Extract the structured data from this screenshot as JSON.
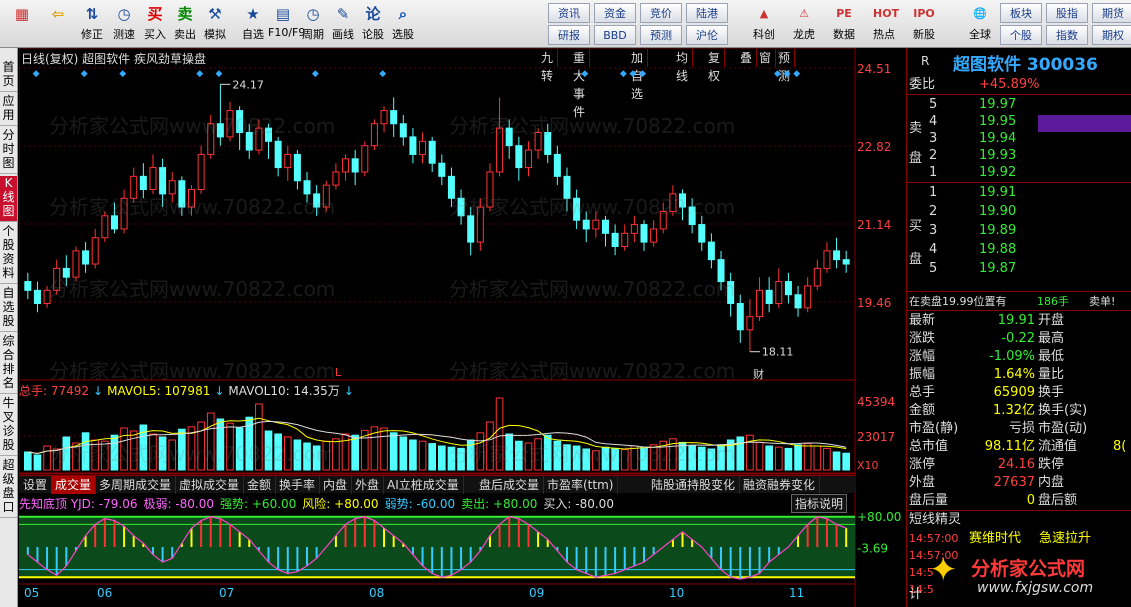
{
  "toolbar": {
    "left": [
      {
        "label": "",
        "icon": "grid-icon"
      },
      {
        "label": "",
        "icon": "back-arrow-icon"
      },
      {
        "label": "修正",
        "icon": "updown-icon"
      },
      {
        "label": "测速",
        "icon": "clock-icon"
      },
      {
        "label": "买入",
        "icon": "buy-icon",
        "glyph": "买"
      },
      {
        "label": "卖出",
        "icon": "sell-icon",
        "glyph": "卖"
      },
      {
        "label": "模拟",
        "icon": "hammer-icon"
      },
      {
        "label": "自选",
        "icon": "star-icon"
      },
      {
        "label": "F10/F9",
        "icon": "f10-icon"
      },
      {
        "label": "周期",
        "icon": "clock-icon"
      },
      {
        "label": "画线",
        "icon": "pen-icon"
      },
      {
        "label": "论股",
        "icon": "chat-icon"
      },
      {
        "label": "选股",
        "icon": "magnifier-icon"
      }
    ],
    "grid1": [
      "资讯",
      "资金",
      "竞价",
      "陆港"
    ],
    "grid2": [
      "研报",
      "BBD",
      "预测",
      "沪伦"
    ],
    "right": [
      {
        "label": "科创"
      },
      {
        "label": "龙虎"
      },
      {
        "label": "数据"
      },
      {
        "label": "热点"
      },
      {
        "label": "新股"
      },
      {
        "label": "全球"
      }
    ],
    "grid3": [
      "板块",
      "股指",
      "期货"
    ],
    "grid4": [
      "个股",
      "指数",
      "期权"
    ]
  },
  "leftnav": [
    "首页",
    "应用",
    "分时图",
    "K线图",
    "个股资料",
    "自选股",
    "综合排名",
    "牛叉诊股",
    "超级盘口"
  ],
  "chart_header": {
    "title": "日线(复权)  超图软件 疾风劲草操盘",
    "buttons": [
      "九转",
      "重大事件",
      "加自选",
      "均线",
      "复权",
      "叠",
      "窗",
      "预测"
    ]
  },
  "chart_data": {
    "type": "candlestick",
    "ylim": [
      17.5,
      24.8
    ],
    "yticks": [
      "24.51",
      "22.82",
      "21.14",
      "19.46"
    ],
    "high_label": "24.17",
    "low_label": "18.11",
    "xticks": [
      "05",
      "06",
      "07",
      "08",
      "09",
      "10",
      "11"
    ],
    "candles": [
      [
        19.7,
        19.5,
        19.9,
        19.3
      ],
      [
        19.5,
        19.2,
        19.7,
        19.0
      ],
      [
        19.2,
        19.5,
        19.6,
        19.1
      ],
      [
        19.5,
        20.0,
        20.2,
        19.4
      ],
      [
        20.0,
        19.8,
        20.3,
        19.6
      ],
      [
        19.8,
        20.4,
        20.5,
        19.7
      ],
      [
        20.4,
        20.1,
        20.6,
        19.9
      ],
      [
        20.1,
        20.7,
        20.9,
        20.0
      ],
      [
        20.7,
        21.2,
        21.3,
        20.6
      ],
      [
        21.2,
        20.9,
        21.5,
        20.8
      ],
      [
        20.9,
        21.6,
        21.8,
        20.8
      ],
      [
        21.6,
        22.1,
        22.3,
        21.5
      ],
      [
        22.1,
        21.8,
        22.4,
        21.6
      ],
      [
        21.8,
        22.3,
        22.6,
        21.7
      ],
      [
        22.3,
        21.7,
        22.5,
        21.4
      ],
      [
        21.7,
        22.0,
        22.2,
        21.5
      ],
      [
        22.0,
        21.4,
        22.1,
        21.2
      ],
      [
        21.4,
        21.8,
        21.9,
        21.2
      ],
      [
        21.8,
        22.6,
        22.8,
        21.7
      ],
      [
        22.6,
        23.3,
        23.5,
        22.5
      ],
      [
        23.3,
        23.0,
        24.2,
        22.8
      ],
      [
        23.0,
        23.6,
        23.8,
        22.9
      ],
      [
        23.6,
        23.1,
        23.7,
        22.7
      ],
      [
        23.1,
        22.7,
        23.3,
        22.5
      ],
      [
        22.7,
        23.2,
        23.4,
        22.6
      ],
      [
        23.2,
        22.9,
        23.3,
        22.5
      ],
      [
        22.9,
        22.3,
        23.0,
        22.1
      ],
      [
        22.3,
        22.6,
        22.8,
        22.0
      ],
      [
        22.6,
        22.0,
        22.7,
        21.8
      ],
      [
        22.0,
        21.7,
        22.2,
        21.5
      ],
      [
        21.7,
        21.4,
        21.9,
        21.2
      ],
      [
        21.4,
        21.9,
        22.0,
        21.3
      ],
      [
        21.9,
        22.2,
        22.4,
        21.8
      ],
      [
        22.2,
        22.5,
        22.6,
        22.0
      ],
      [
        22.5,
        22.2,
        22.7,
        21.9
      ],
      [
        22.2,
        22.8,
        22.9,
        22.1
      ],
      [
        22.8,
        23.3,
        23.4,
        22.7
      ],
      [
        23.3,
        23.6,
        23.7,
        23.1
      ],
      [
        23.6,
        23.3,
        23.9,
        23.0
      ],
      [
        23.3,
        23.0,
        23.5,
        22.8
      ],
      [
        23.0,
        22.6,
        23.2,
        22.4
      ],
      [
        22.6,
        22.9,
        23.1,
        22.4
      ],
      [
        22.9,
        22.4,
        23.0,
        22.2
      ],
      [
        22.4,
        22.1,
        22.6,
        21.9
      ],
      [
        22.1,
        21.6,
        22.3,
        21.4
      ],
      [
        21.6,
        21.2,
        21.8,
        21.0
      ],
      [
        21.2,
        20.6,
        21.4,
        20.3
      ],
      [
        20.6,
        21.4,
        21.6,
        20.4
      ],
      [
        21.4,
        22.2,
        22.4,
        21.3
      ],
      [
        22.2,
        23.2,
        23.9,
        22.1
      ],
      [
        23.2,
        22.8,
        23.4,
        22.5
      ],
      [
        22.8,
        22.3,
        23.0,
        22.0
      ],
      [
        22.3,
        22.7,
        22.9,
        22.1
      ],
      [
        22.7,
        23.1,
        23.2,
        22.5
      ],
      [
        23.1,
        22.6,
        23.3,
        22.4
      ],
      [
        22.6,
        22.1,
        22.8,
        21.9
      ],
      [
        22.1,
        21.6,
        22.3,
        21.3
      ],
      [
        21.6,
        21.1,
        21.8,
        20.9
      ],
      [
        21.1,
        20.9,
        21.3,
        20.6
      ],
      [
        20.9,
        21.1,
        21.3,
        20.7
      ],
      [
        21.1,
        20.8,
        21.2,
        20.5
      ],
      [
        20.8,
        20.5,
        21.0,
        20.3
      ],
      [
        20.5,
        20.8,
        21.0,
        20.4
      ],
      [
        20.8,
        21.0,
        21.2,
        20.6
      ],
      [
        21.0,
        20.6,
        21.1,
        20.4
      ],
      [
        20.6,
        20.9,
        21.1,
        20.5
      ],
      [
        20.9,
        21.3,
        21.5,
        20.8
      ],
      [
        21.3,
        21.7,
        21.9,
        21.2
      ],
      [
        21.7,
        21.4,
        21.8,
        21.1
      ],
      [
        21.4,
        21.0,
        21.6,
        20.8
      ],
      [
        21.0,
        20.6,
        21.2,
        20.4
      ],
      [
        20.6,
        20.2,
        20.8,
        20.0
      ],
      [
        20.2,
        19.7,
        20.4,
        19.5
      ],
      [
        19.7,
        19.2,
        19.9,
        18.9
      ],
      [
        19.2,
        18.6,
        19.4,
        18.3
      ],
      [
        18.6,
        18.9,
        19.3,
        18.1
      ],
      [
        18.9,
        19.5,
        19.8,
        18.8
      ],
      [
        19.5,
        19.2,
        19.8,
        19.0
      ],
      [
        19.2,
        19.7,
        20.0,
        19.1
      ],
      [
        19.7,
        19.4,
        19.9,
        19.2
      ],
      [
        19.4,
        19.1,
        19.6,
        18.9
      ],
      [
        19.1,
        19.6,
        19.8,
        19.0
      ],
      [
        19.6,
        20.0,
        20.2,
        19.5
      ],
      [
        20.0,
        20.4,
        20.6,
        19.9
      ],
      [
        20.4,
        20.2,
        20.7,
        20.0
      ],
      [
        20.2,
        20.1,
        20.4,
        19.9
      ]
    ]
  },
  "volume": {
    "header": [
      {
        "t": "总手: 77492",
        "c": "#ff4040"
      },
      {
        "t": "MAVOL5: 107981",
        "c": "#ffff00"
      },
      {
        "t": "MAVOL10: 14.35万",
        "c": "#ddd"
      }
    ],
    "ticks": [
      "45394",
      "23017"
    ],
    "unit": "X10",
    "bars": [
      30,
      25,
      40,
      35,
      55,
      45,
      62,
      50,
      48,
      58,
      70,
      65,
      75,
      60,
      55,
      50,
      68,
      72,
      80,
      95,
      85,
      78,
      70,
      88,
      110,
      65,
      60,
      55,
      50,
      45,
      40,
      48,
      52,
      60,
      58,
      66,
      72,
      70,
      62,
      55,
      50,
      48,
      44,
      40,
      38,
      36,
      50,
      62,
      80,
      120,
      60,
      48,
      45,
      52,
      58,
      48,
      42,
      40,
      35,
      32,
      38,
      36,
      34,
      40,
      38,
      42,
      48,
      52,
      46,
      40,
      38,
      35,
      42,
      50,
      55,
      58,
      46,
      40,
      38,
      36,
      42,
      44,
      40,
      36,
      30,
      28
    ]
  },
  "tabs": [
    "设置",
    "成交量",
    "多周期成交量",
    "虚拟成交量",
    "金额",
    "换手率",
    "内盘",
    "外盘",
    "AI立桩成交量",
    "盘后成交量",
    "市盈率(ttm)",
    "陆股通持股变化",
    "融资融券变化"
  ],
  "indicator": {
    "header": [
      {
        "t": "先知底顶 YJD: -79.06",
        "c": "#ff66ff"
      },
      {
        "t": "极弱: -80.00",
        "c": "#ff66ff"
      },
      {
        "t": "强势: +60.00",
        "c": "#33ee33"
      },
      {
        "t": "风险: +80.00",
        "c": "#ffff00"
      },
      {
        "t": "弱势: -60.00",
        "c": "#33ccff"
      },
      {
        "t": "卖出: +80.00",
        "c": "#33ee33"
      },
      {
        "t": "买入: -80.00",
        "c": "#ddd"
      }
    ],
    "button": "指标说明",
    "ticks": [
      "+80.00",
      "-3.69"
    ],
    "values": [
      -20,
      -40,
      -60,
      -75,
      -50,
      -10,
      30,
      60,
      75,
      70,
      55,
      30,
      10,
      -20,
      -40,
      -30,
      10,
      50,
      70,
      80,
      75,
      60,
      40,
      20,
      -10,
      -40,
      -60,
      -70,
      -65,
      -50,
      -30,
      0,
      30,
      60,
      75,
      80,
      70,
      50,
      30,
      10,
      -20,
      -50,
      -70,
      -80,
      -75,
      -60,
      -40,
      -10,
      30,
      60,
      80,
      75,
      60,
      40,
      20,
      -10,
      -40,
      -60,
      -70,
      -80,
      -75,
      -70,
      -60,
      -50,
      -40,
      -20,
      0,
      20,
      40,
      20,
      0,
      -30,
      -60,
      -80,
      -85,
      -80,
      -70,
      -40,
      -20,
      0,
      30,
      60,
      80,
      75,
      60,
      50
    ]
  },
  "right": {
    "title": "超图软件 300036",
    "r_mark": "R",
    "weibi_label": "委比",
    "weibi": "+45.89%",
    "sell": [
      {
        "n": "5",
        "p": "19.97"
      },
      {
        "n": "4",
        "p": "19.95"
      },
      {
        "n": "3",
        "p": "19.94"
      },
      {
        "n": "2",
        "p": "19.93"
      },
      {
        "n": "1",
        "p": "19.92"
      }
    ],
    "buy": [
      {
        "n": "1",
        "p": "19.91"
      },
      {
        "n": "2",
        "p": "19.90"
      },
      {
        "n": "3",
        "p": "19.89"
      },
      {
        "n": "4",
        "p": "19.88"
      },
      {
        "n": "5",
        "p": "19.87"
      }
    ],
    "sell_label": [
      "卖",
      "盘"
    ],
    "buy_label": [
      "买",
      "盘"
    ],
    "notice": "在卖盘19.99位置有",
    "notice_vol": "186手",
    "notice_tail": "卖单!",
    "stats": [
      {
        "l": "最新",
        "v": "19.91",
        "c": "#33ee33",
        "l2": "开盘"
      },
      {
        "l": "涨跌",
        "v": "-0.22",
        "c": "#33ee33",
        "l2": "最高"
      },
      {
        "l": "涨幅",
        "v": "-1.09%",
        "c": "#33ee33",
        "l2": "最低"
      },
      {
        "l": "振幅",
        "v": "1.64%",
        "c": "#ffff00",
        "l2": "量比"
      },
      {
        "l": "总手",
        "v": "65909",
        "c": "#ffff00",
        "l2": "换手"
      },
      {
        "l": "金额",
        "v": "1.32亿",
        "c": "#ffff00",
        "l2": "换手(实)"
      },
      {
        "l": "市盈(静)",
        "v": "亏损",
        "c": "#ddd",
        "l2": "市盈(动)"
      },
      {
        "l": "总市值",
        "v": "98.11亿",
        "c": "#ffff00",
        "l2": "流通值"
      },
      {
        "l": "涨停",
        "v": "24.16",
        "c": "#ff4040",
        "l2": "跌停"
      },
      {
        "l": "外盘",
        "v": "27637",
        "c": "#ff4040",
        "l2": "内盘"
      },
      {
        "l": "盘后量",
        "v": "0",
        "c": "#ffff00",
        "l2": "盘后额"
      }
    ],
    "liutong_tail": "8(",
    "short_title": "短线精灵",
    "short": [
      {
        "t": "14:57:00",
        "n": "赛维时代",
        "e": "急速拉升"
      },
      {
        "t": "14:57:00",
        "n": "",
        "e": ""
      },
      {
        "t": "14:5",
        "n": "",
        "e": ""
      },
      {
        "t": "14:5",
        "n": "",
        "e": ""
      }
    ],
    "bottom_label": "计"
  },
  "watermark": "分析家公式网www.70822.com",
  "logo": {
    "text": "分析家公式网",
    "url": "www.fxjgsw.com"
  }
}
